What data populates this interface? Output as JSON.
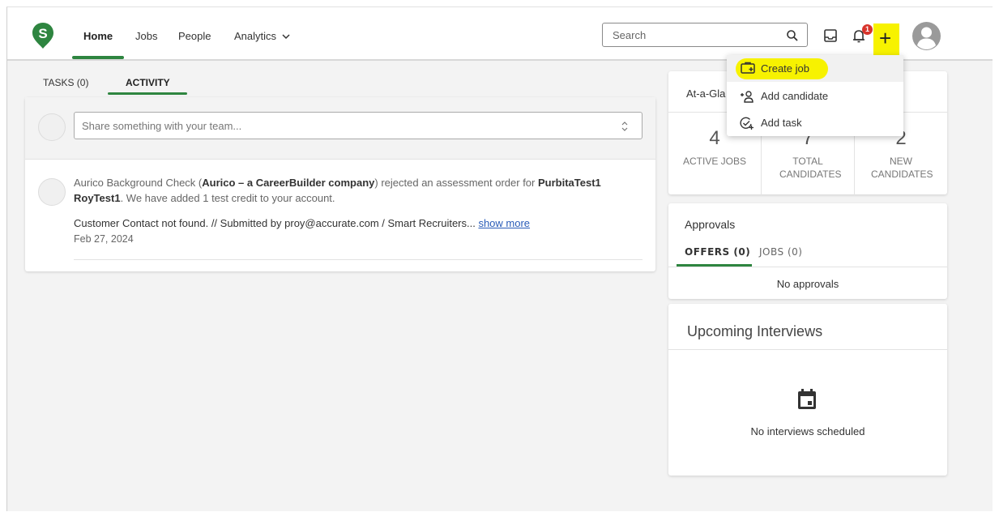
{
  "nav": {
    "items": [
      "Home",
      "Jobs",
      "People",
      "Analytics"
    ],
    "active": "Home"
  },
  "search": {
    "placeholder": "Search"
  },
  "notifications": {
    "count": "1"
  },
  "tabs": [
    {
      "label": "TASKS (0)",
      "active": false
    },
    {
      "label": "ACTIVITY",
      "active": true
    }
  ],
  "share": {
    "placeholder": "Share something with your team..."
  },
  "feed": {
    "item": {
      "part1": "Aurico Background Check (",
      "company": "Aurico – a CareerBuilder company",
      "part2": ") rejected an assessment order for ",
      "candidate": "PurbitaTest1 RoyTest1",
      "part3": ". We have added 1 test credit to your account.",
      "detail": "Customer Contact not found. // Submitted by proy@accurate.com / Smart Recruiters... ",
      "show_more": "show more",
      "date": "Feb 27, 2024"
    }
  },
  "glance": {
    "title": "At-a-Gla",
    "stats": [
      {
        "value": "4",
        "label": "ACTIVE JOBS"
      },
      {
        "value": "7",
        "label": "TOTAL CANDIDATES"
      },
      {
        "value": "2",
        "label": "NEW CANDIDATES"
      }
    ]
  },
  "approvals": {
    "title": "Approvals",
    "tabs": [
      "OFFERS (0)",
      "JOBS (0)"
    ],
    "empty": "No approvals"
  },
  "interviews": {
    "title": "Upcoming Interviews",
    "empty": "No interviews scheduled"
  },
  "create_menu": {
    "items": [
      "Create job",
      "Add candidate",
      "Add task"
    ]
  },
  "colors": {
    "accent_green": "#2e8540",
    "highlight_yellow": "#f7f200",
    "badge_red": "#d8342c"
  }
}
